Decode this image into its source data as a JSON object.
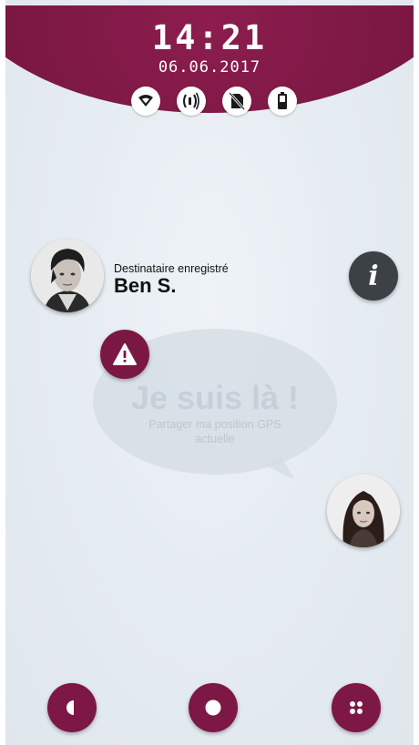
{
  "status_bar": {
    "time": "14:21",
    "date": "06.06.2017",
    "icons": [
      "wifi-icon",
      "sound-icon",
      "no-sim-icon",
      "battery-icon"
    ]
  },
  "recipient": {
    "caption": "Destinataire enregistré",
    "name": "Ben S.",
    "avatar": "man-portrait"
  },
  "info_button": {
    "icon": "info-icon",
    "glyph": "i"
  },
  "alert_button": {
    "icon": "warning-icon"
  },
  "bubble": {
    "title": "Je suis là !",
    "subtitle": "Partager ma position GPS actuelle"
  },
  "second_contact": {
    "avatar": "woman-portrait"
  },
  "bottom_nav": {
    "left_icon": "half-circle-icon",
    "center_icon": "record-icon",
    "right_icon": "apps-grid-icon"
  },
  "colors": {
    "accent": "#7b1743",
    "info_button": "#3b4145",
    "background": "#e4ebf1"
  }
}
